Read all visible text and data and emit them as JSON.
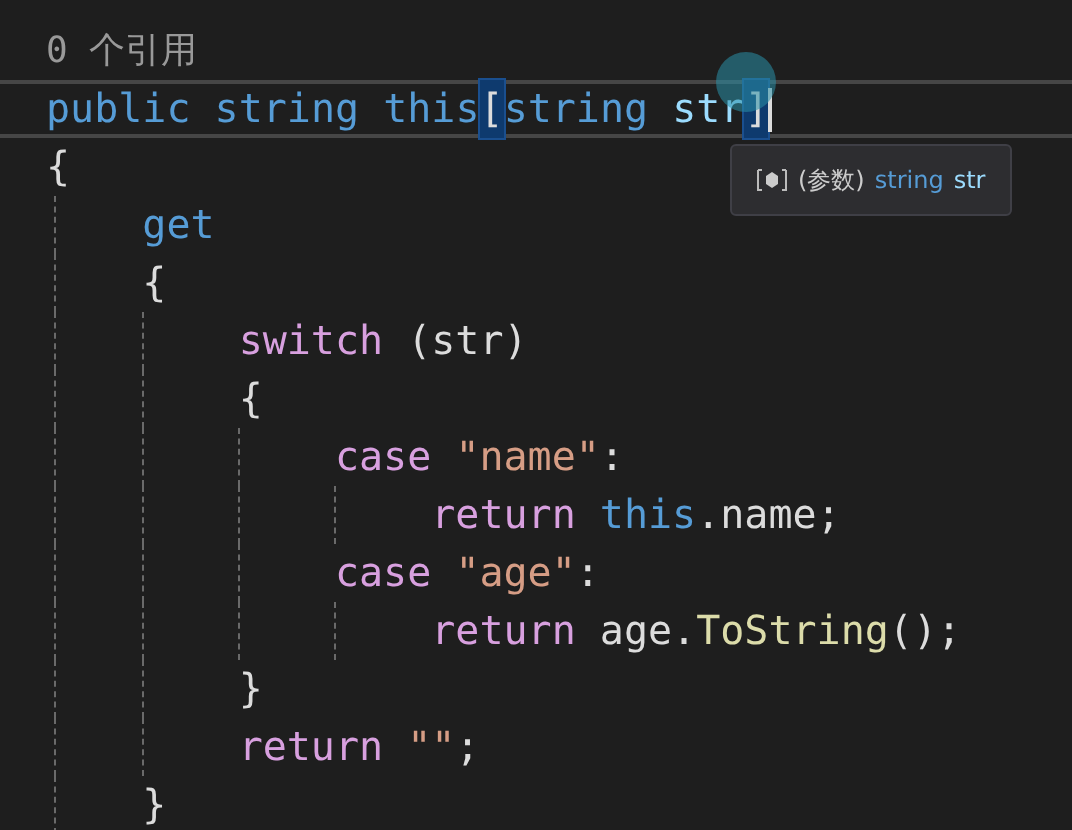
{
  "codelens": "0 个引用",
  "lines": [
    {
      "current": true,
      "tokens": [
        {
          "text": "public ",
          "kind": "keyword"
        },
        {
          "text": "string ",
          "kind": "keyword"
        },
        {
          "text": "this",
          "kind": "keyword"
        },
        {
          "text": "[",
          "kind": "bracket-match"
        },
        {
          "text": "string ",
          "kind": "keyword"
        },
        {
          "text": "str",
          "kind": "param"
        },
        {
          "text": "]",
          "kind": "bracket-match"
        }
      ]
    },
    {
      "current": false,
      "tokens": [
        {
          "text": "{",
          "kind": "plain"
        }
      ]
    },
    {
      "current": false,
      "tokens": [
        {
          "text": "    get",
          "kind": "keyword"
        }
      ]
    },
    {
      "current": false,
      "tokens": [
        {
          "text": "    {",
          "kind": "plain"
        }
      ]
    },
    {
      "current": false,
      "tokens": [
        {
          "text": "        switch",
          "kind": "control"
        },
        {
          "text": " (str)",
          "kind": "plain"
        }
      ]
    },
    {
      "current": false,
      "tokens": [
        {
          "text": "        {",
          "kind": "plain"
        }
      ]
    },
    {
      "current": false,
      "tokens": [
        {
          "text": "            case ",
          "kind": "control"
        },
        {
          "text": "\"name\"",
          "kind": "string"
        },
        {
          "text": ":",
          "kind": "plain"
        }
      ]
    },
    {
      "current": false,
      "tokens": [
        {
          "text": "                return ",
          "kind": "control"
        },
        {
          "text": "this",
          "kind": "keyword"
        },
        {
          "text": ".name;",
          "kind": "plain"
        }
      ]
    },
    {
      "current": false,
      "tokens": [
        {
          "text": "            case ",
          "kind": "control"
        },
        {
          "text": "\"age\"",
          "kind": "string"
        },
        {
          "text": ":",
          "kind": "plain"
        }
      ]
    },
    {
      "current": false,
      "tokens": [
        {
          "text": "                return",
          "kind": "control"
        },
        {
          "text": " age.",
          "kind": "plain"
        },
        {
          "text": "ToString",
          "kind": "method"
        },
        {
          "text": "();",
          "kind": "plain"
        }
      ]
    },
    {
      "current": false,
      "tokens": [
        {
          "text": "        }",
          "kind": "plain"
        }
      ]
    },
    {
      "current": false,
      "tokens": [
        {
          "text": "        return ",
          "kind": "control"
        },
        {
          "text": "\"\"",
          "kind": "string"
        },
        {
          "text": ";",
          "kind": "plain"
        }
      ]
    },
    {
      "current": false,
      "tokens": [
        {
          "text": "    }",
          "kind": "plain"
        }
      ]
    }
  ],
  "tooltip": {
    "label": "(参数)",
    "type": "string",
    "name": "str"
  }
}
